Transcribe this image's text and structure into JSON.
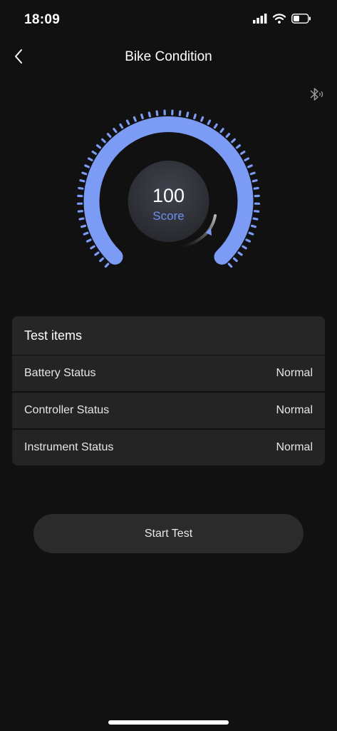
{
  "status": {
    "time": "18:09"
  },
  "nav": {
    "title": "Bike Condition"
  },
  "gauge": {
    "score": "100",
    "score_label": "Score",
    "level": 1.0,
    "accent_color": "#7b9bf5"
  },
  "test_card": {
    "title": "Test items",
    "rows": [
      {
        "label": "Battery Status",
        "value": "Normal"
      },
      {
        "label": "Controller Status",
        "value": "Normal"
      },
      {
        "label": "Instrument Status",
        "value": "Normal"
      }
    ]
  },
  "actions": {
    "start_label": "Start Test"
  },
  "icons": {
    "back": "chevron-left-icon",
    "bluetooth": "bluetooth-icon",
    "signal": "cellular-signal-icon",
    "wifi": "wifi-icon",
    "battery": "battery-icon"
  }
}
